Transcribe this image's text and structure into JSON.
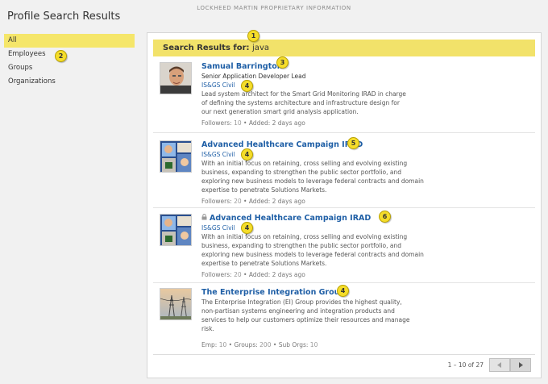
{
  "banner": "LOCKHEED MARTIN PROPRIETARY INFORMATION",
  "page_title": "Profile Search Results",
  "sidebar": {
    "items": [
      {
        "label": "All"
      },
      {
        "label": "Employees"
      },
      {
        "label": "Groups"
      },
      {
        "label": "Organizations"
      }
    ],
    "selected": "All"
  },
  "results_header": {
    "label": "Search Results for:",
    "query": "java"
  },
  "results": [
    {
      "title": "Samual Barrington",
      "subtitle": "Senior Application Developer Lead",
      "org": "IS&GS Civil",
      "desc": [
        "Lead system architect for the Smart Grid Monitoring IRAD in charge",
        "of defining the systems architecture and  infrastructure design for",
        "our next generation smart grid analysis application."
      ],
      "meta_prefix": "Followers:",
      "followers": "10",
      "meta_sep": " • ",
      "added": "Added: 2 days ago",
      "thumb_icon": "person-photo"
    },
    {
      "title": "Advanced Healthcare Campaign IRAD",
      "org": "IS&GS Civil",
      "desc": [
        "With an initial focus on retaining, cross selling and evolving existing",
        "business, expanding to strengthen the public sector portfolio, and",
        "exploring new business models to leverage federal contracts and domain",
        "expertise to penetrate Solutions Markets."
      ],
      "meta_prefix": "Followers:",
      "followers": "20",
      "meta_sep": " • ",
      "added": "Added: 2 days ago",
      "thumb_icon": "group-collage"
    },
    {
      "title": "Advanced Healthcare Campaign IRAD",
      "locked": true,
      "org": "IS&GS Civil",
      "desc": [
        "With an initial focus on retaining, cross selling and evolving existing",
        "business, expanding to strengthen the public sector portfolio, and",
        "exploring new business models to leverage federal contracts and domain",
        "expertise to penetrate Solutions Markets."
      ],
      "meta_prefix": "Followers:",
      "followers": "20",
      "meta_sep": " • ",
      "added": "Added: 2 days ago",
      "thumb_icon": "group-collage"
    },
    {
      "title": "The Enterprise Integration Group",
      "desc": [
        "The Enterprise Integration (EI) Group provides the highest quality,",
        "non-partisan systems engineering and integration products and",
        "services to help our customers optimize their resources and manage",
        "risk."
      ],
      "meta": [
        {
          "label": "Emp:",
          "value": "10"
        },
        {
          "label": "Groups:",
          "value": "200"
        },
        {
          "label": "Sub Orgs:",
          "value": "10"
        }
      ],
      "meta_sep": " • ",
      "thumb_icon": "power-lines"
    }
  ],
  "callouts": [
    "1",
    "2",
    "3",
    "4",
    "4",
    "5",
    "4",
    "6",
    "4",
    "4"
  ],
  "pager": {
    "text": "1 – 10 of 27"
  },
  "colors": {
    "highlight": "#f2e26a",
    "link": "#1f5fa6",
    "callout": "#f5dd2a"
  }
}
